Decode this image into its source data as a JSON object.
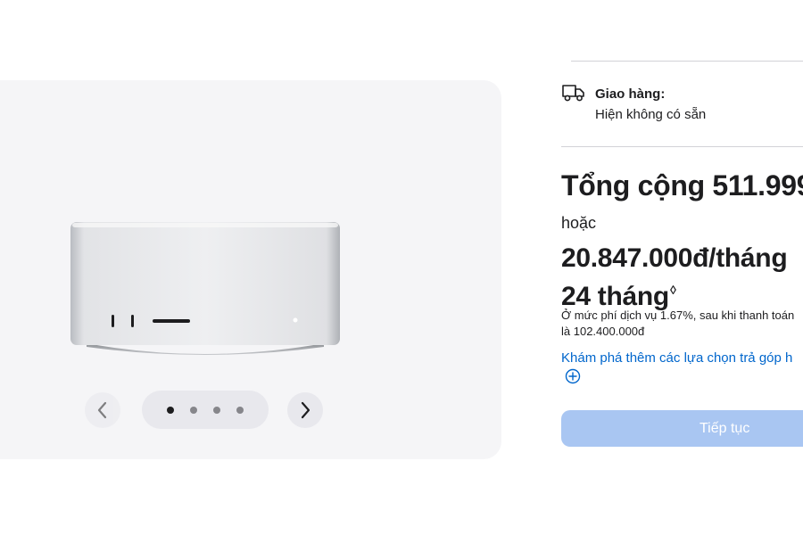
{
  "gallery": {
    "image_alt": "Mac Studio",
    "prev_icon": "chevron-left-icon",
    "next_icon": "chevron-right-icon",
    "dots": {
      "count": 4,
      "active_index": 0
    }
  },
  "delivery": {
    "icon": "truck-icon",
    "title": "Giao hàng:",
    "status": "Hiện không có sẵn"
  },
  "pricing": {
    "total": "Tổng cộng 511.999",
    "or_label": "hoặc",
    "monthly": "20.847.000đ/tháng",
    "months": "24 tháng",
    "months_marker": "◊",
    "fee_line1": "Ở mức phí dịch vụ 1.67%, sau khi thanh toán",
    "fee_line2": "là 102.400.000đ"
  },
  "financing": {
    "link_label": "Khám phá thêm các lựa chọn trả góp h",
    "plus_icon": "plus-circle-icon"
  },
  "actions": {
    "continue_label": "Tiếp tục",
    "continue_color": "#a9c6f2"
  },
  "colors": {
    "link": "#0066cc",
    "panel": "#f5f5f7",
    "text": "#1d1d1f"
  }
}
